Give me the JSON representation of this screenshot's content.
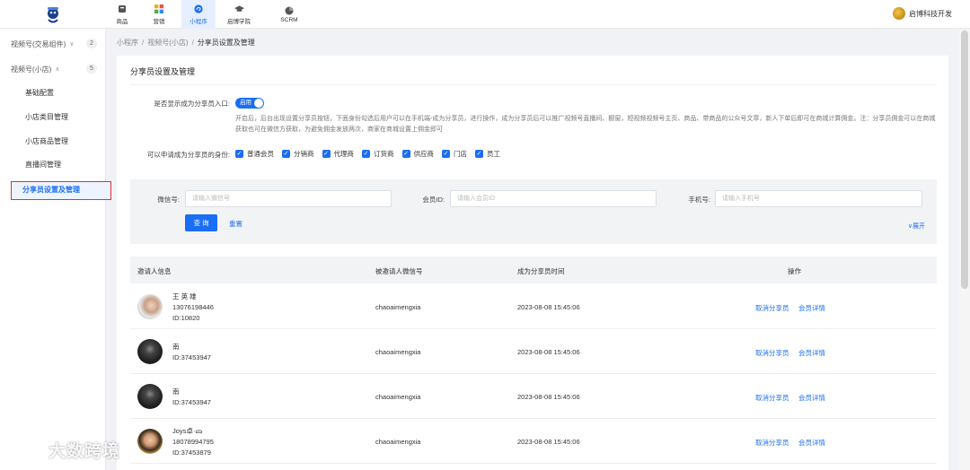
{
  "topnav": {
    "items": [
      {
        "label": "商品",
        "icon": "box-icon"
      },
      {
        "label": "营销",
        "icon": "grid-icon"
      },
      {
        "label": "小程序",
        "icon": "mini-program-icon"
      },
      {
        "label": "启博学院",
        "icon": "graduation-cap-icon"
      },
      {
        "label": "SCRM",
        "icon": "pie-chart-icon"
      }
    ],
    "active_index": 2,
    "company": "启博科技开发"
  },
  "sidebar": {
    "groups": [
      {
        "label": "视频号(交易组件)",
        "count": "2",
        "expanded": false
      },
      {
        "label": "视频号(小店)",
        "count": "5",
        "expanded": true
      }
    ],
    "items": [
      {
        "label": "基础配置"
      },
      {
        "label": "小店类目管理"
      },
      {
        "label": "小店商品管理"
      },
      {
        "label": "直播间管理"
      },
      {
        "label": "分享员设置及管理"
      }
    ],
    "active_index": 4
  },
  "breadcrumb": [
    "小程序",
    "视频号(小店)",
    "分享员设置及管理"
  ],
  "page": {
    "title": "分享员设置及管理",
    "show_entry_label": "是否显示成为分享员入口:",
    "toggle_text": "启用",
    "toggle_on": true,
    "description": "开启后，后台出现设置分享员按钮，下面身份勾选后用户可以在手机端-成为分享员，进行操作，成为分享员后可以推广视频号直播间、橱窗，短视频视频号主页、商品、带商品的公众号文章，新人下单后即可在商城计算佣金。注：分享员佣金可以在商城获取也可在微信方获取，为避免佣金发放两次，商家在商城设置上佣金即可",
    "identity_label": "可以申请成为分享员的身份:",
    "identities": [
      "普通会员",
      "分销商",
      "代理商",
      "订货商",
      "供应商",
      "门店",
      "员工"
    ]
  },
  "filter": {
    "wechat_label": "微信号:",
    "wechat_placeholder": "请输入微信号",
    "member_label": "会员ID:",
    "member_placeholder": "请输入会员ID",
    "phone_label": "手机号:",
    "phone_placeholder": "请输入手机号",
    "query_label": "查 询",
    "reset_label": "重置",
    "expand_label": "∨展开"
  },
  "table": {
    "headers": [
      "邀请人信息",
      "被邀请人微信号",
      "成为分享员时间",
      "操作"
    ],
    "rows": [
      {
        "name": "王 英 雄",
        "phone": "13076198446",
        "id": "ID:10820",
        "wechat": "chaoaimengxia",
        "time": "2023-08-08 15:45:06",
        "action1": "取消分享员",
        "action2": "会员详情"
      },
      {
        "name": "南",
        "phone": "",
        "id": "ID:37453947",
        "wechat": "chaoaimengxia",
        "time": "2023-08-08 15:45:06",
        "action1": "取消分享员",
        "action2": "会员详情"
      },
      {
        "name": "南",
        "phone": "",
        "id": "ID:37453947",
        "wechat": "chaoaimengxia",
        "time": "2023-08-08 15:45:06",
        "action1": "取消分享员",
        "action2": "会员详情"
      },
      {
        "name": "Joys卓·ᯅ",
        "phone": "18078994795",
        "id": "ID:37453879",
        "wechat": "chaoaimengxia",
        "time": "2023-08-08 15:45:06",
        "action1": "取消分享员",
        "action2": "会员详情"
      }
    ]
  },
  "watermark": "大数跨境",
  "colors": {
    "primary": "#1a6ef5",
    "highlight_border": "#e0303a",
    "filter_bg": "#f2f3f5"
  }
}
